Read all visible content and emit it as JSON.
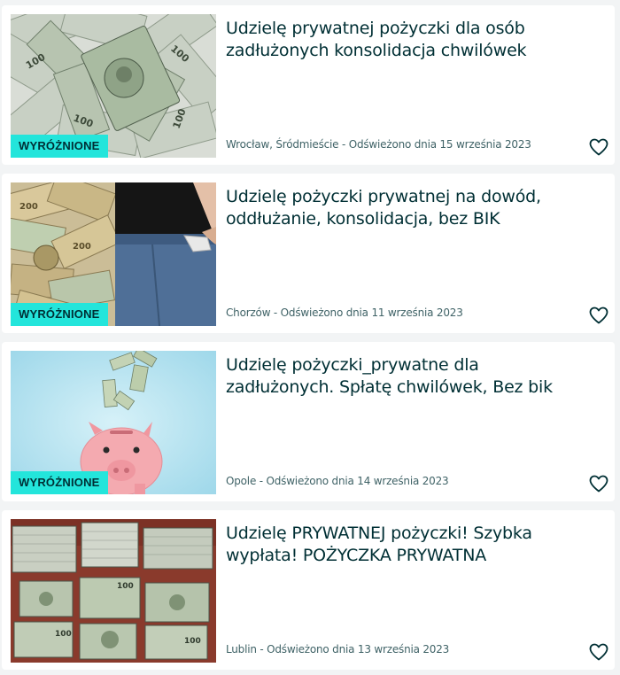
{
  "listings": [
    {
      "title": "Udzielę prywatnej pożyczki dla osób zadłużonych konsolidacja chwilówek",
      "badge": "WYRÓŻNIONE",
      "meta": "Wrocław, Śródmieście - Odświeżono dnia 15 września 2023",
      "image": "banknotes-fan-photo",
      "favorite_icon": "heart-outline-icon"
    },
    {
      "title": "Udzielę pożyczki prywatnej na dowód, oddłużanie, konsolidacja, bez BIK",
      "badge": "WYRÓŻNIONE",
      "meta": "Chorzów - Odświeżono dnia 11 września 2023",
      "image": "money-and-empty-pocket-photo",
      "favorite_icon": "heart-outline-icon"
    },
    {
      "title": "Udzielę pożyczki_prywatne dla zadłużonych. Spłatę chwilówek, Bez bik",
      "badge": "WYRÓŻNIONE",
      "meta": "Opole - Odświeżono dnia 14 września 2023",
      "image": "piggy-bank-photo",
      "favorite_icon": "heart-outline-icon"
    },
    {
      "title": "Udzielę PRYWATNEJ pożyczki! Szybka wypłata! POŻYCZKA PRYWATNA",
      "badge": "",
      "meta": "Lublin - Odświeżono dnia 13 września 2023",
      "image": "cash-stacks-photo",
      "favorite_icon": "heart-outline-icon"
    }
  ],
  "colors": {
    "badge_bg": "#23e5db",
    "text_primary": "#002f34",
    "text_secondary": "#406367",
    "page_bg": "#f2f4f5"
  }
}
